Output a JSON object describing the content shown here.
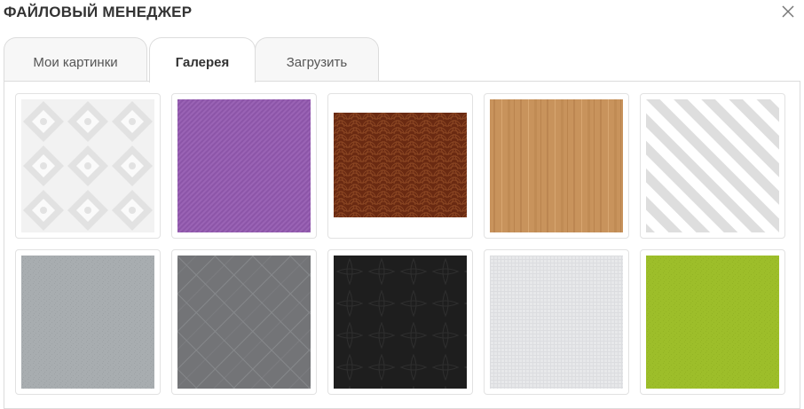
{
  "dialog": {
    "title": "ФАЙЛОВЫЙ МЕНЕДЖЕР"
  },
  "icons": {
    "close": "close-icon"
  },
  "tabs": [
    {
      "label": "Мои картинки",
      "active": false
    },
    {
      "label": "Галерея",
      "active": true
    },
    {
      "label": "Загрузить",
      "active": false
    }
  ],
  "gallery": [
    {
      "name": "damask-white",
      "pattern": "damask",
      "colors": [
        "#f2f2f2",
        "#e2e2e2",
        "#fafafa"
      ]
    },
    {
      "name": "purple-diagonal",
      "pattern": "diagonal-fine",
      "colors": [
        "#9a63b5",
        "#8c55a8"
      ]
    },
    {
      "name": "brown-waves",
      "pattern": "seigaiha",
      "colors": [
        "#6a2a12",
        "#8a4522"
      ]
    },
    {
      "name": "light-wood",
      "pattern": "wood",
      "colors": [
        "#c8935c",
        "#b07a45",
        "#d8a670"
      ]
    },
    {
      "name": "gray-stripes",
      "pattern": "diagonal-wide",
      "colors": [
        "#ffffff",
        "#dedede"
      ]
    },
    {
      "name": "light-gray-texture",
      "pattern": "noise",
      "colors": [
        "#a8adb0",
        "#9ea3a6"
      ]
    },
    {
      "name": "gray-argyle",
      "pattern": "argyle",
      "colors": [
        "#737477",
        "#86888b"
      ]
    },
    {
      "name": "black-ornament",
      "pattern": "ornament",
      "colors": [
        "#1e1e1e",
        "#2e2e2e"
      ]
    },
    {
      "name": "white-linen",
      "pattern": "linen",
      "colors": [
        "#e7e8ea",
        "#dcdde0"
      ]
    },
    {
      "name": "lime-green",
      "pattern": "noise",
      "colors": [
        "#9dbe2a",
        "#94b424"
      ]
    }
  ]
}
